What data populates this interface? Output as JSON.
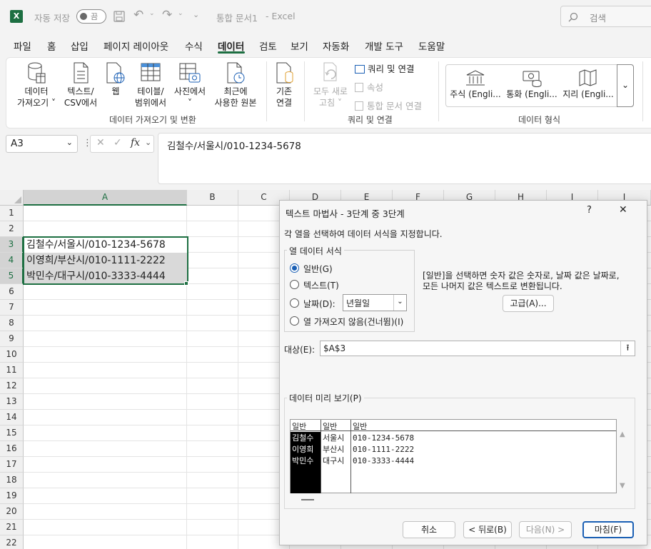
{
  "titlebar": {
    "autosave_label": "자동 저장",
    "autosave_state": "끔",
    "doc_title": "통합 문서1",
    "app_suffix": "- Excel",
    "search_placeholder": "검색"
  },
  "menu_tabs": [
    "파일",
    "홈",
    "삽입",
    "페이지 레이아웃",
    "수식",
    "데이터",
    "검토",
    "보기",
    "자동화",
    "개발 도구",
    "도움말"
  ],
  "ribbon": {
    "get_data_line1": "데이터",
    "get_data_line2": "가져오기",
    "text_csv_line1": "텍스트/",
    "text_csv_line2": "CSV에서",
    "web": "웹",
    "table_line1": "테이블/",
    "table_line2": "범위에서",
    "picture_line1": "사진에서",
    "recent_line1": "최근에",
    "recent_line2": "사용한 원본",
    "existing_line1": "기존",
    "existing_line2": "연결",
    "group1": "데이터 가져오기 및 변환",
    "refresh_line1": "모두 새로",
    "refresh_line2": "고침",
    "queries": "쿼리 및 연결",
    "properties": "속성",
    "workbook_links": "통합 문서 연결",
    "group2": "쿼리 및 연결",
    "stocks": "주식 (Engli...",
    "currency": "통화 (Engli...",
    "geography": "지리 (Engli...",
    "group3": "데이터 형식"
  },
  "formula_bar": {
    "name_box": "A3",
    "formula": "김철수/서울시/010-1234-5678"
  },
  "sheet": {
    "columns": [
      "A",
      "B",
      "C",
      "D",
      "E",
      "F",
      "G",
      "H",
      "I",
      "J"
    ],
    "rows": [
      "1",
      "2",
      "3",
      "4",
      "5",
      "6",
      "7",
      "8",
      "9",
      "10",
      "11",
      "12",
      "13",
      "14",
      "15",
      "16",
      "17",
      "18",
      "19",
      "20",
      "21",
      "22"
    ],
    "cells": [
      "김철수/서울시/010-1234-5678",
      "이영희/부산시/010-1111-2222",
      "박민수/대구시/010-3333-4444"
    ]
  },
  "dialog": {
    "title": "텍스트 마법사 - 3단계 중 3단계",
    "help": "?",
    "close": "✕",
    "instruction": "각 열을 선택하여 데이터 서식을 지정합니다.",
    "format_group": "열 데이터 서식",
    "opt_general": "일반(G)",
    "opt_text": "텍스트(T)",
    "opt_date": "날짜(D):",
    "date_value": "년월일",
    "opt_skip": "열 가져오지 않음(건너뜀)(I)",
    "note_line1": "[일반]을 선택하면 숫자 값은 숫자로, 날짜 값은 날짜로,",
    "note_line2": "모든 나머지 값은 텍스트로 변환됩니다.",
    "advanced": "고급(A)...",
    "dest_label": "대상(E):",
    "dest_value": "$A$3",
    "preview_label": "데이터 미리 보기(P)",
    "preview_headers": [
      "일반",
      "일반",
      "일반"
    ],
    "preview_col1": [
      "김철수",
      "이영희",
      "박민수"
    ],
    "preview_col2": [
      "서울시",
      "부산시",
      "대구시"
    ],
    "preview_col3": [
      "010-1234-5678",
      "010-1111-2222",
      "010-3333-4444"
    ],
    "cancel": "취소",
    "back": "< 뒤로(B)",
    "next": "다음(N) >",
    "finish": "마침(F)"
  }
}
